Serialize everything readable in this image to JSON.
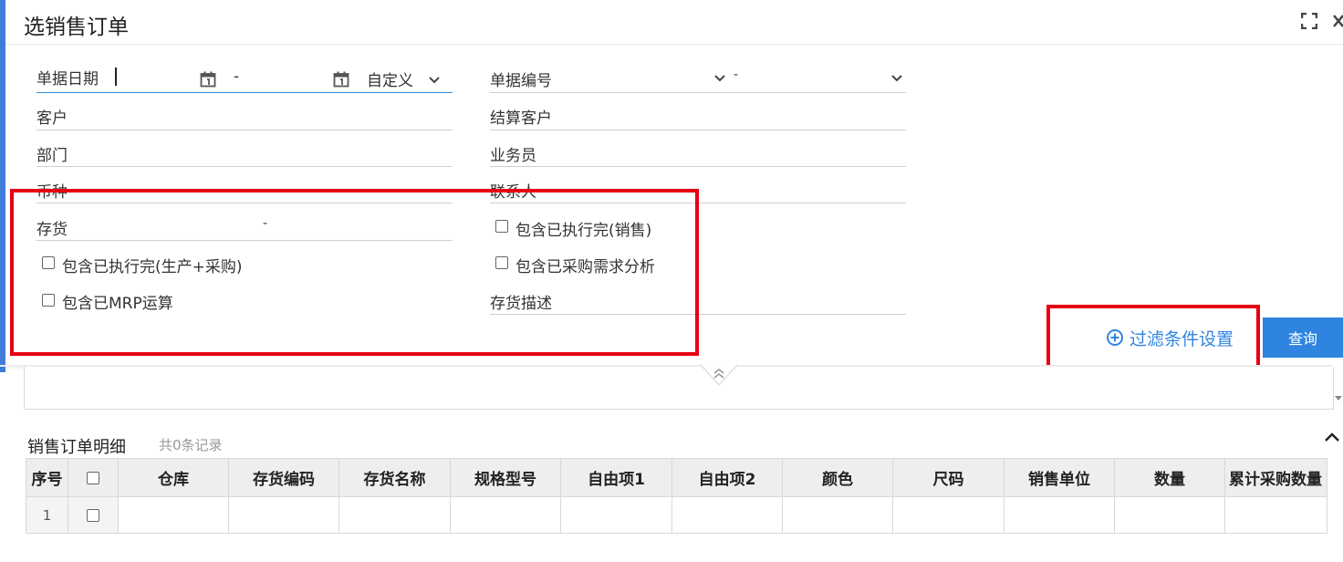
{
  "dialog": {
    "title": "选销售订单"
  },
  "filters": {
    "doc_date_label": "单据日期",
    "date_sep": "-",
    "date_range_value": "自定义",
    "doc_no_label": "单据编号",
    "doc_no_sep": "-",
    "customer_label": "客户",
    "settle_customer_label": "结算客户",
    "department_label": "部门",
    "salesperson_label": "业务员",
    "currency_label": "币种",
    "contact_label": "联系人",
    "inventory_label": "存货",
    "inventory_sep": "-",
    "inventory_desc_label": "存货描述"
  },
  "checkboxes": {
    "include_done_sales": "包含已执行完(销售)",
    "include_done_prod": "包含已执行完(生产+采购)",
    "include_purchase_analysis": "包含已采购需求分析",
    "include_mrp": "包含已MRP运算"
  },
  "actions": {
    "filter_settings": "过滤条件设置",
    "query": "查询"
  },
  "detail": {
    "title": "销售订单明细",
    "count": "共0条记录",
    "columns": [
      "序号",
      "仓库",
      "存货编码",
      "存货名称",
      "规格型号",
      "自由项1",
      "自由项2",
      "颜色",
      "尺码",
      "销售单位",
      "数量",
      "累计采购数量"
    ],
    "rows": [
      {
        "seq": "1"
      }
    ]
  }
}
